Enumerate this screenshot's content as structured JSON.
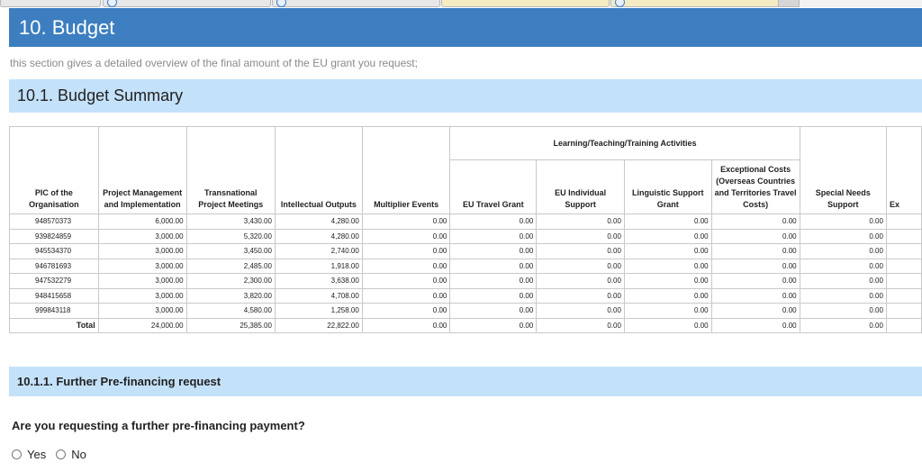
{
  "page": {
    "section_title": "10. Budget",
    "section_description": "this section gives a detailed overview of the final amount of the EU grant you request;",
    "summary_title": "10.1. Budget Summary"
  },
  "table": {
    "group_header": "Learning/Teaching/Training Activities",
    "columns": {
      "pic": "PIC of the Organisation",
      "pm": "Project Management and Implementation",
      "tpm": "Transnational Project Meetings",
      "io": "Intellectual Outputs",
      "me": "Multiplier Events",
      "eutg": "EU Travel Grant",
      "euis": "EU Individual Support",
      "ls": "Linguistic Support Grant",
      "ec": "Exceptional Costs (Overseas Countries and Territories Travel Costs)",
      "sns": "Special Needs Support",
      "ex": "Ex"
    },
    "rows": [
      {
        "pic": "948570373",
        "pm": "6,000.00",
        "tpm": "3,430.00",
        "io": "4,280.00",
        "me": "0.00",
        "eutg": "0.00",
        "euis": "0.00",
        "ls": "0.00",
        "ec": "0.00",
        "sns": "0.00"
      },
      {
        "pic": "939824859",
        "pm": "3,000.00",
        "tpm": "5,320.00",
        "io": "4,280.00",
        "me": "0.00",
        "eutg": "0.00",
        "euis": "0.00",
        "ls": "0.00",
        "ec": "0.00",
        "sns": "0.00"
      },
      {
        "pic": "945534370",
        "pm": "3,000.00",
        "tpm": "3,450.00",
        "io": "2,740.00",
        "me": "0.00",
        "eutg": "0.00",
        "euis": "0.00",
        "ls": "0.00",
        "ec": "0.00",
        "sns": "0.00"
      },
      {
        "pic": "946781693",
        "pm": "3,000.00",
        "tpm": "2,485.00",
        "io": "1,918.00",
        "me": "0.00",
        "eutg": "0.00",
        "euis": "0.00",
        "ls": "0.00",
        "ec": "0.00",
        "sns": "0.00"
      },
      {
        "pic": "947532279",
        "pm": "3,000.00",
        "tpm": "2,300.00",
        "io": "3,638.00",
        "me": "0.00",
        "eutg": "0.00",
        "euis": "0.00",
        "ls": "0.00",
        "ec": "0.00",
        "sns": "0.00"
      },
      {
        "pic": "948415658",
        "pm": "3,000.00",
        "tpm": "3,820.00",
        "io": "4,708.00",
        "me": "0.00",
        "eutg": "0.00",
        "euis": "0.00",
        "ls": "0.00",
        "ec": "0.00",
        "sns": "0.00"
      },
      {
        "pic": "999843118",
        "pm": "3,000.00",
        "tpm": "4,580.00",
        "io": "1,258.00",
        "me": "0.00",
        "eutg": "0.00",
        "euis": "0.00",
        "ls": "0.00",
        "ec": "0.00",
        "sns": "0.00"
      }
    ],
    "total": {
      "label": "Total",
      "pm": "24,000.00",
      "tpm": "25,385.00",
      "io": "22,822.00",
      "me": "0.00",
      "eutg": "0.00",
      "euis": "0.00",
      "ls": "0.00",
      "ec": "0.00",
      "sns": "0.00"
    }
  },
  "prefinancing": {
    "title": "10.1.1. Further Pre-financing request",
    "question": "Are you requesting a further pre-financing payment?",
    "options": [
      "Yes",
      "No"
    ]
  }
}
